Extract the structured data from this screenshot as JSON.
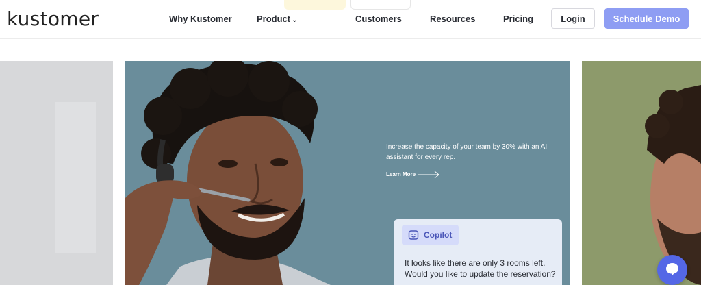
{
  "brand": {
    "logo_text": "kustomer"
  },
  "nav": {
    "items": [
      {
        "label": "Why Kustomer"
      },
      {
        "label": "Product"
      },
      {
        "label": "Customers"
      },
      {
        "label": "Resources"
      },
      {
        "label": "Pricing"
      }
    ],
    "login_label": "Login",
    "demo_label": "Schedule Demo"
  },
  "hero": {
    "headline": "Increase the capacity of your team by 30% with an AI assistant for every rep.",
    "learn_more": "Learn More"
  },
  "copilot": {
    "label": "Copilot",
    "message": "It looks like there are only 3 rooms left. Would you like to update the reservation?"
  },
  "icons": {
    "product_dropdown": "chevron-down-icon",
    "learn_more": "arrow-right-icon",
    "copilot": "copilot-face-icon",
    "chat": "chat-bubble-icon"
  },
  "colors": {
    "accent": "#8e9df3",
    "hero_bg": "#6a8d9b",
    "copilot_chip": "#d5dbfa",
    "copilot_text": "#4a56b8",
    "chat_button": "#5467e6"
  }
}
